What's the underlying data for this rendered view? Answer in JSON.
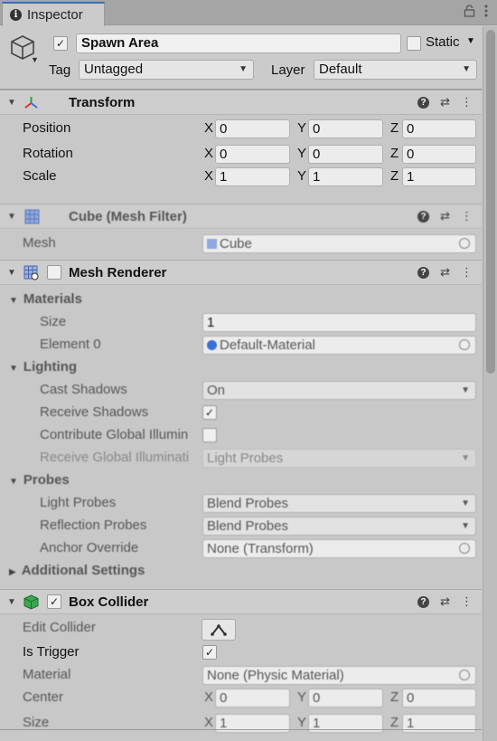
{
  "tab": {
    "title": "Inspector"
  },
  "gameobject": {
    "name": "Spawn Area",
    "active": true,
    "static_label": "Static",
    "tag_label": "Tag",
    "tag_value": "Untagged",
    "layer_label": "Layer",
    "layer_value": "Default"
  },
  "transform": {
    "title": "Transform",
    "position_label": "Position",
    "rotation_label": "Rotation",
    "scale_label": "Scale",
    "axis_x": "X",
    "axis_y": "Y",
    "axis_z": "Z",
    "position": {
      "x": "0",
      "y": "0",
      "z": "0"
    },
    "rotation": {
      "x": "0",
      "y": "0",
      "z": "0"
    },
    "scale": {
      "x": "1",
      "y": "1",
      "z": "1"
    }
  },
  "mesh_filter": {
    "title": "Cube (Mesh Filter)",
    "mesh_label": "Mesh",
    "mesh_value": "Cube"
  },
  "mesh_renderer": {
    "title": "Mesh Renderer",
    "materials_label": "Materials",
    "size_label": "Size",
    "size_value": "1",
    "element0_label": "Element 0",
    "element0_value": "Default-Material",
    "lighting_label": "Lighting",
    "cast_shadows_label": "Cast Shadows",
    "cast_shadows_value": "On",
    "receive_shadows_label": "Receive Shadows",
    "contribute_gi_label": "Contribute Global Illumin",
    "receive_gi_label": "Receive Global Illuminati",
    "receive_gi_value": "Light Probes",
    "probes_label": "Probes",
    "light_probes_label": "Light Probes",
    "light_probes_value": "Blend Probes",
    "reflection_probes_label": "Reflection Probes",
    "reflection_probes_value": "Blend Probes",
    "anchor_override_label": "Anchor Override",
    "anchor_override_value": "None (Transform)",
    "additional_settings_label": "Additional Settings"
  },
  "box_collider": {
    "title": "Box Collider",
    "edit_collider_label": "Edit Collider",
    "is_trigger_label": "Is Trigger",
    "material_label": "Material",
    "material_value": "None (Physic Material)",
    "center_label": "Center",
    "size_label": "Size",
    "center": {
      "x": "0",
      "y": "0",
      "z": "0"
    },
    "size": {
      "x": "1",
      "y": "1",
      "z": "1"
    }
  },
  "colors": {
    "tab_accent": "#3a72b0",
    "collider_green": "#2f9e44",
    "mesh_blue": "#6f8fd0"
  }
}
